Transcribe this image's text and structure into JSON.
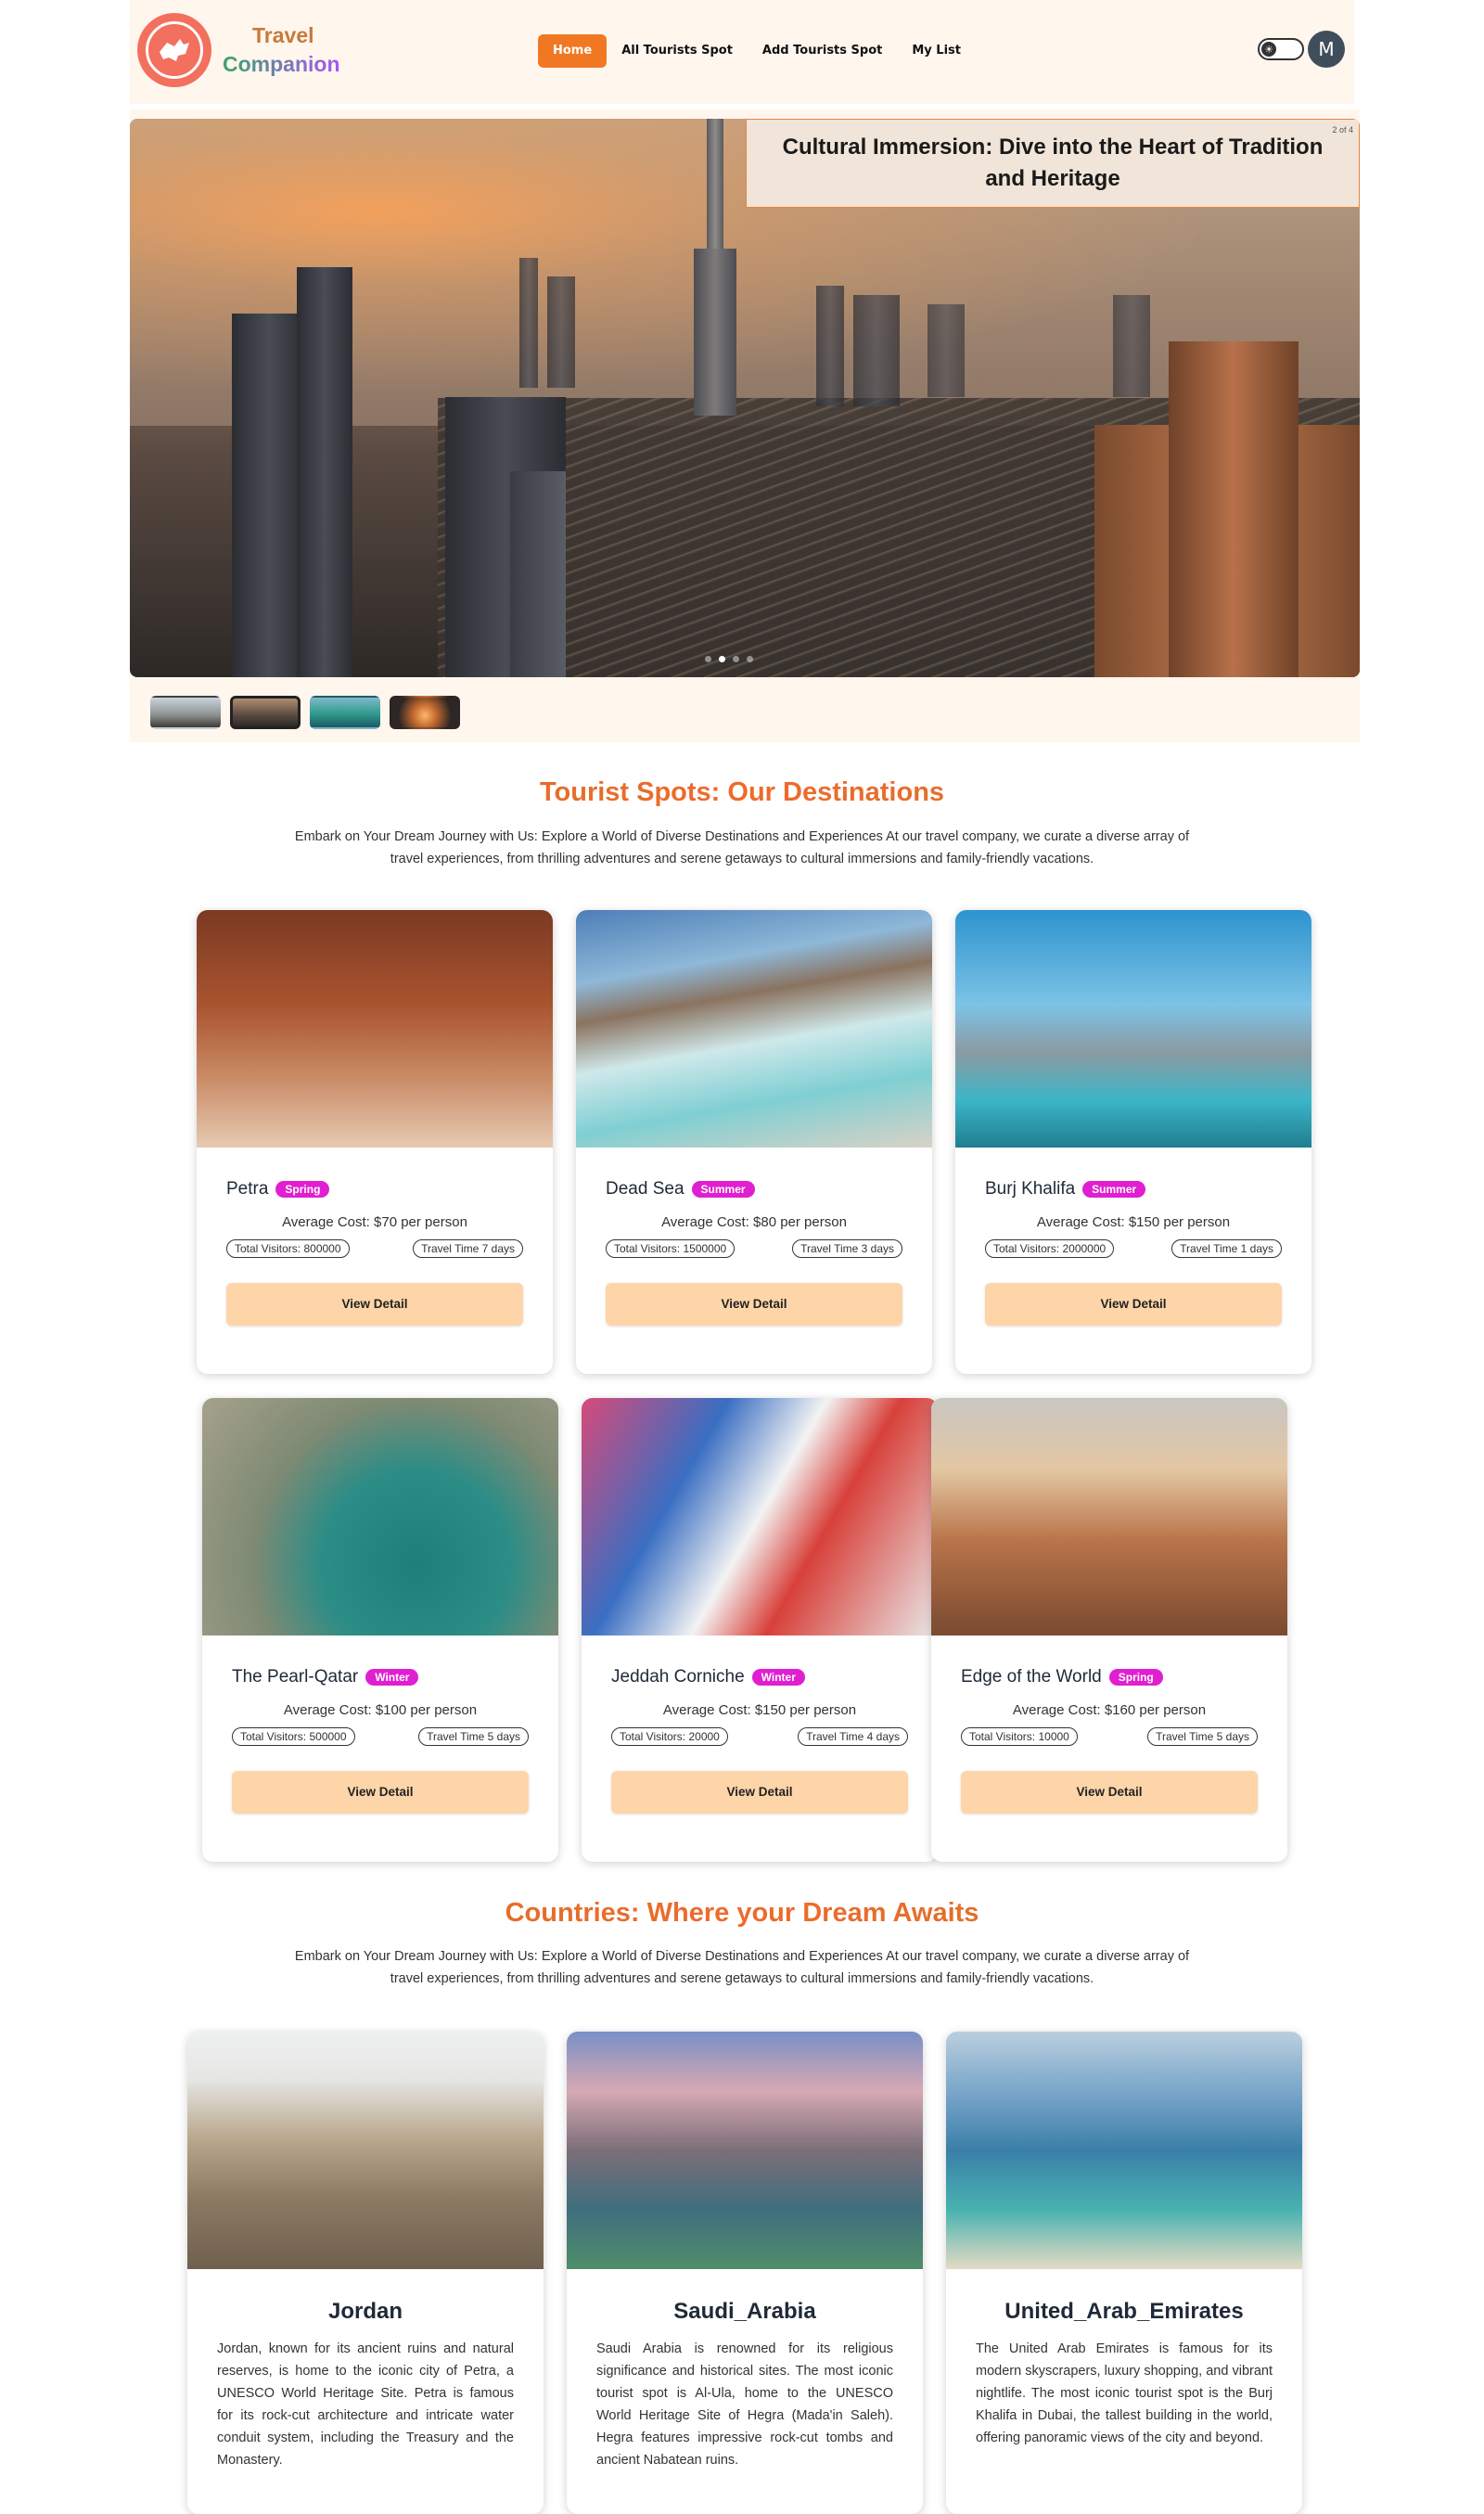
{
  "brand": {
    "line1": "Travel",
    "line2": "Companion"
  },
  "nav": {
    "items": [
      {
        "label": "Home",
        "active": true
      },
      {
        "label": "All Tourists Spot"
      },
      {
        "label": "Add Tourists Spot"
      },
      {
        "label": "My List"
      }
    ],
    "avatar_initial": "M"
  },
  "hero": {
    "caption": "Cultural Immersion: Dive into the Heart of Tradition and Heritage",
    "pager": "2 of 4",
    "active_index": 2,
    "total": 4
  },
  "spots_section": {
    "title": "Tourist Spots: Our Destinations",
    "description": "Embark on Your Dream Journey with Us: Explore a World of Diverse Destinations and Experiences At our travel company, we curate a diverse array of travel experiences, from thrilling adventures and serene getaways to cultural immersions and family-friendly vacations."
  },
  "spots": [
    {
      "name": "Petra",
      "season": "Spring",
      "cost": "Average Cost: $70 per person",
      "visitors": "Total Visitors: 800000",
      "travel_time": "Travel Time 7 days",
      "button": "View Detail"
    },
    {
      "name": "Dead Sea",
      "season": "Summer",
      "cost": "Average Cost: $80 per person",
      "visitors": "Total Visitors: 1500000",
      "travel_time": "Travel Time 3 days",
      "button": "View Detail"
    },
    {
      "name": "Burj Khalifa",
      "season": "Summer",
      "cost": "Average Cost: $150 per person",
      "visitors": "Total Visitors: 2000000",
      "travel_time": "Travel Time 1 days",
      "button": "View Detail"
    },
    {
      "name": "The Pearl-Qatar",
      "season": "Winter",
      "cost": "Average Cost: $100 per person",
      "visitors": "Total Visitors: 500000",
      "travel_time": "Travel Time 5 days",
      "button": "View Detail"
    },
    {
      "name": "Jeddah Corniche",
      "season": "Winter",
      "cost": "Average Cost: $150 per person",
      "visitors": "Total Visitors: 20000",
      "travel_time": "Travel Time 4 days",
      "button": "View Detail"
    },
    {
      "name": "Edge of the World",
      "season": "Spring",
      "cost": "Average Cost: $160 per person",
      "visitors": "Total Visitors: 10000",
      "travel_time": "Travel Time 5 days",
      "button": "View Detail"
    }
  ],
  "countries_section": {
    "title": "Countries: Where your Dream Awaits",
    "description": "Embark on Your Dream Journey with Us: Explore a World of Diverse Destinations and Experiences At our travel company, we curate a diverse array of travel experiences, from thrilling adventures and serene getaways to cultural immersions and family-friendly vacations."
  },
  "countries": [
    {
      "name": "Jordan",
      "description": "Jordan, known for its ancient ruins and natural reserves, is home to the iconic city of Petra, a UNESCO World Heritage Site. Petra is famous for its rock-cut architecture and intricate water conduit system, including the Treasury and the Monastery."
    },
    {
      "name": "Saudi_Arabia",
      "description": "Saudi Arabia is renowned for its religious significance and historical sites. The most iconic tourist spot is Al-Ula, home to the UNESCO World Heritage Site of Hegra (Mada'in Saleh). Hegra features impressive rock-cut tombs and ancient Nabatean ruins."
    },
    {
      "name": "United_Arab_Emirates",
      "description": "The United Arab Emirates is famous for its modern skyscrapers, luxury shopping, and vibrant nightlife. The most iconic tourist spot is the Burj Khalifa in Dubai, the tallest building in the world, offering panoramic views of the city and beyond."
    }
  ]
}
